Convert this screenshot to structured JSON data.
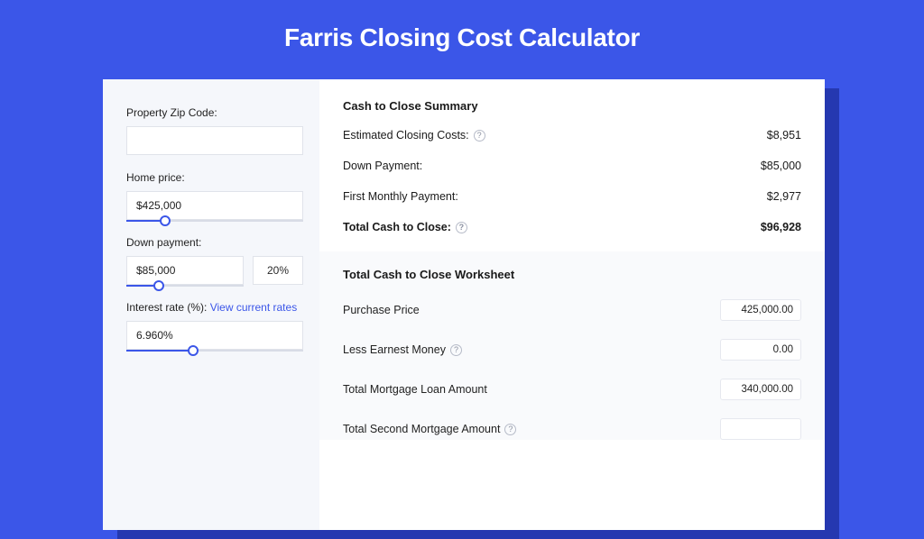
{
  "title": "Farris Closing Cost Calculator",
  "left": {
    "zip_label": "Property Zip Code:",
    "zip_value": "",
    "home_price_label": "Home price:",
    "home_price_value": "$425,000",
    "home_price_fill_pct": 22,
    "down_payment_label": "Down payment:",
    "down_payment_value": "$85,000",
    "down_payment_pct": "20%",
    "down_payment_fill_pct": 28,
    "interest_label": "Interest rate (%): ",
    "interest_link": "View current rates",
    "interest_value": "6.960%",
    "interest_fill_pct": 38
  },
  "summary": {
    "title": "Cash to Close Summary",
    "rows": [
      {
        "label": "Estimated Closing Costs:",
        "help": true,
        "value": "$8,951"
      },
      {
        "label": "Down Payment:",
        "help": false,
        "value": "$85,000"
      },
      {
        "label": "First Monthly Payment:",
        "help": false,
        "value": "$2,977"
      }
    ],
    "total_label": "Total Cash to Close:",
    "total_value": "$96,928"
  },
  "worksheet": {
    "title": "Total Cash to Close Worksheet",
    "rows": [
      {
        "label": "Purchase Price",
        "help": false,
        "value": "425,000.00"
      },
      {
        "label": "Less Earnest Money",
        "help": true,
        "value": "0.00"
      },
      {
        "label": "Total Mortgage Loan Amount",
        "help": false,
        "value": "340,000.00"
      },
      {
        "label": "Total Second Mortgage Amount",
        "help": true,
        "value": ""
      }
    ]
  }
}
